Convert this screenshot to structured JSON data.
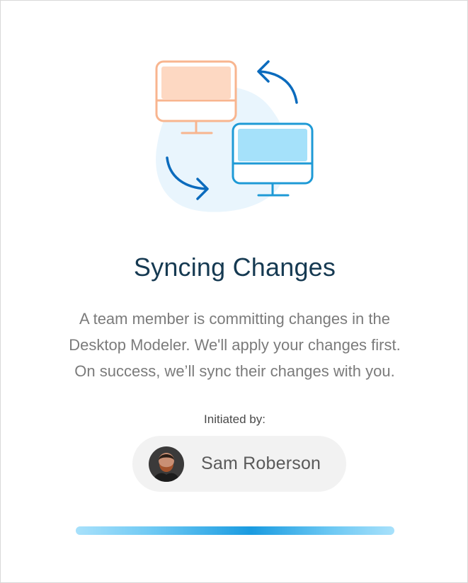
{
  "dialog": {
    "illustration_icon": "computer-sync-icon",
    "title": "Syncing Changes",
    "message_lines": [
      "A team member is committing changes in the",
      "Desktop Modeler. We'll apply your changes first.",
      "On success, we’ll sync their changes with you."
    ],
    "initiated_label": "Initiated by:",
    "initiator": {
      "name": "Sam Roberson",
      "avatar_icon": "user-avatar-icon"
    },
    "progress": {
      "fraction": 1.0
    }
  },
  "colors": {
    "title": "#163a52",
    "message": "#7b7b7b",
    "accent": "#0b6bbd",
    "computer_left": "#f8b58f",
    "computer_right": "#1e9ad6",
    "progress": "#1a9be0"
  }
}
